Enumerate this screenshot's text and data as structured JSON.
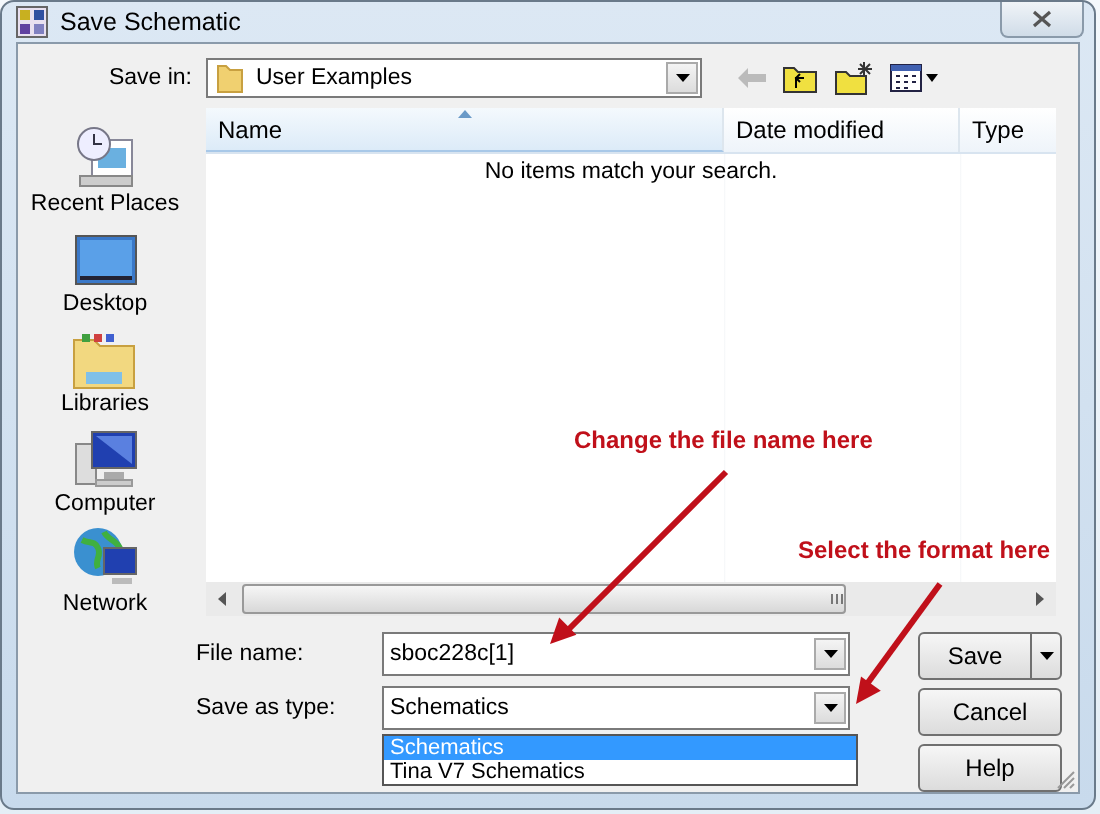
{
  "window": {
    "title": "Save Schematic"
  },
  "save_in": {
    "label": "Save in:",
    "value": "User Examples"
  },
  "sidebar": {
    "items": [
      {
        "label": "Recent Places",
        "kind": "recent"
      },
      {
        "label": "Desktop",
        "kind": "desktop"
      },
      {
        "label": "Libraries",
        "kind": "libraries"
      },
      {
        "label": "Computer",
        "kind": "computer"
      },
      {
        "label": "Network",
        "kind": "network"
      }
    ]
  },
  "file_list": {
    "columns": [
      {
        "label": "Name",
        "sorted": true
      },
      {
        "label": "Date modified",
        "sorted": false
      },
      {
        "label": "Type",
        "sorted": false
      }
    ],
    "empty_message": "No items match your search."
  },
  "file_name": {
    "label": "File name:",
    "value": "sboc228c[1]"
  },
  "save_as_type": {
    "label": "Save as type:",
    "value": "Schematics",
    "expanded": true,
    "options": [
      {
        "label": "Schematics",
        "selected": true
      },
      {
        "label": "Tina V7 Schematics",
        "selected": false
      }
    ]
  },
  "buttons": [
    {
      "label": "Save",
      "kind": "split"
    },
    {
      "label": "Cancel",
      "kind": "plain"
    },
    {
      "label": "Help",
      "kind": "plain"
    }
  ],
  "annotations": [
    {
      "text": "Change the file name here"
    },
    {
      "text": "Select the format here"
    }
  ]
}
